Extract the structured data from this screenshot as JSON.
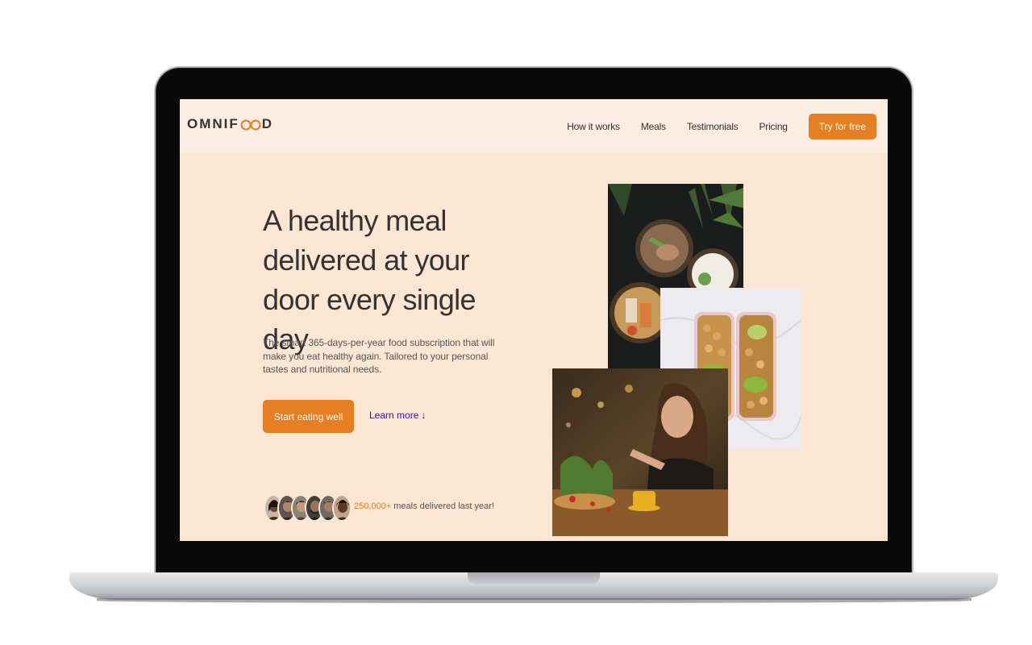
{
  "header": {
    "logo_text_left": "OMNIF",
    "logo_text_right": "D",
    "nav": [
      {
        "label": "How it works"
      },
      {
        "label": "Meals"
      },
      {
        "label": "Testimonials"
      },
      {
        "label": "Pricing"
      }
    ],
    "cta_label": "Try for free"
  },
  "hero": {
    "title": "A healthy meal delivered at your door every single day",
    "description": "The smart 365-days-per-year food subscription that will make you eat healthy again. Tailored to your personal tastes and nutritional needs.",
    "primary_button": "Start eating well",
    "secondary_link": "Learn more",
    "secondary_arrow": "↓"
  },
  "customers": {
    "count": "250,000+",
    "text": " meals delivered last year!"
  },
  "colors": {
    "accent": "#e67e22",
    "hero_bg": "#fbe6d4",
    "header_bg": "#fcede3",
    "text_dark": "#333333",
    "link": "#2a12c9"
  },
  "icons": {
    "learn_more_arrow": "arrow-down-icon",
    "logo_infinity": "infinity-icon"
  }
}
